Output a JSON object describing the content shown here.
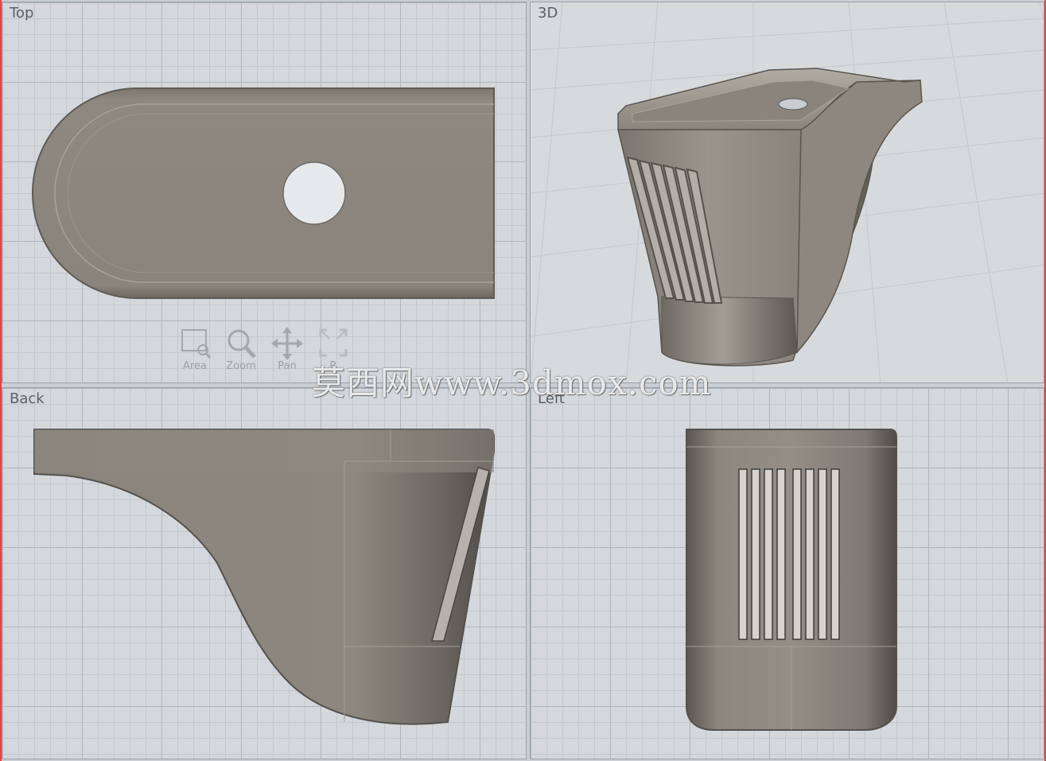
{
  "viewports": {
    "top": {
      "label": "Top"
    },
    "perspective": {
      "label": "3D"
    },
    "back": {
      "label": "Back"
    },
    "left": {
      "label": "Left"
    }
  },
  "nav_tools": [
    {
      "label": "Area",
      "icon": "area-zoom-icon"
    },
    {
      "label": "Zoom",
      "icon": "zoom-icon"
    },
    {
      "label": "Pan",
      "icon": "pan-icon"
    },
    {
      "label": "R",
      "icon": "reset-view-icon"
    }
  ],
  "watermark": "莫西网www.3dmox.com",
  "colors": {
    "model": "#8a847c",
    "grid_bg": "#d4d8dc",
    "frame": "#c9ced3",
    "accent_edge": "#dd4444"
  }
}
